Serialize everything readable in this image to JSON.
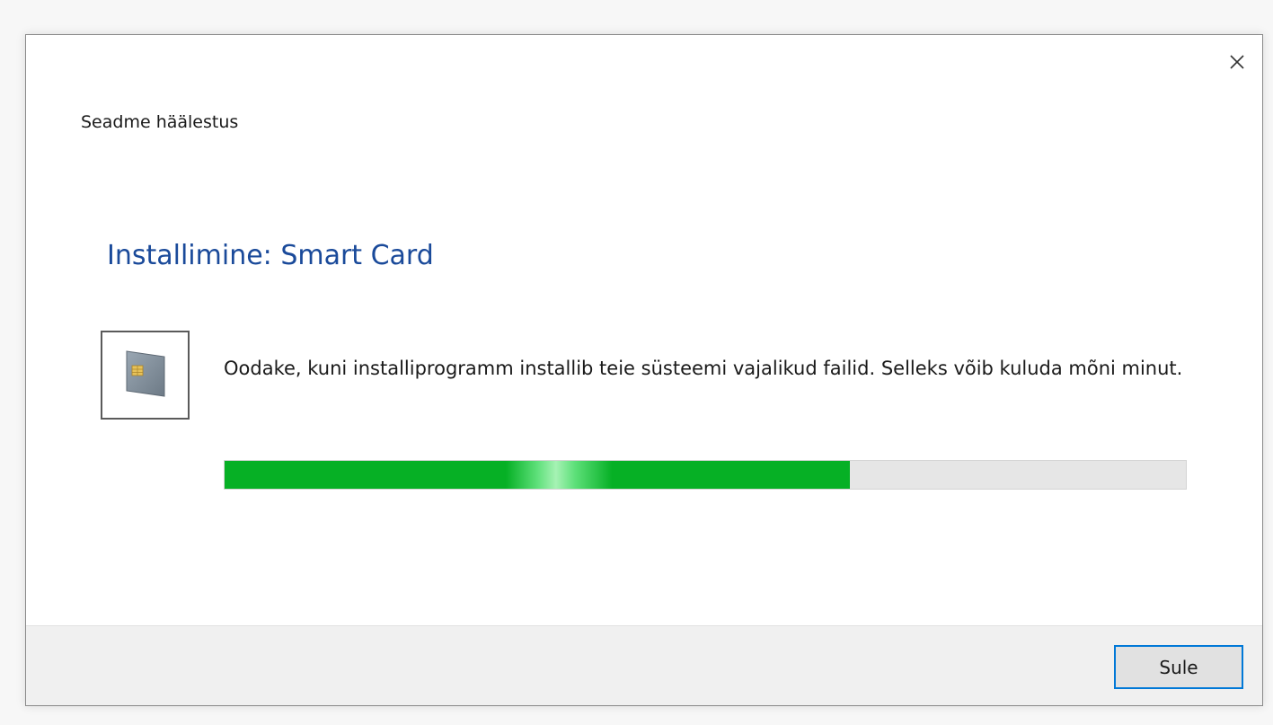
{
  "dialog": {
    "window_title": "Seadme häälestus",
    "heading": "Installimine: Smart Card",
    "message": "Oodake, kuni installiprogramm installib teie süsteemi vajalikud failid. Selleks võib kuluda mõni minut.",
    "device_icon": "smart-card-icon",
    "close_icon": "close-icon"
  },
  "progress": {
    "fraction": 0.65,
    "color": "#06b025"
  },
  "footer": {
    "close_button_label": "Sule"
  },
  "colors": {
    "heading": "#1a4a9a",
    "accent_border": "#0078d7"
  }
}
